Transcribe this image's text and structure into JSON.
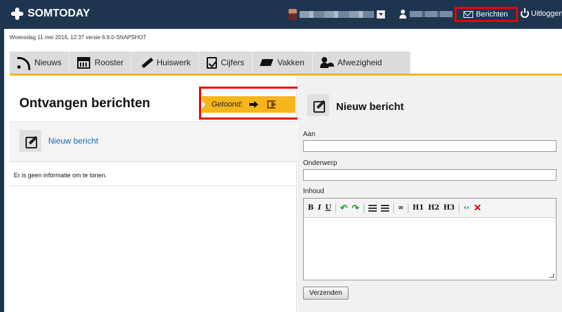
{
  "app": {
    "title": "SOMTODAY"
  },
  "header": {
    "messages_label": "Berichten",
    "logout_label": "Uitloggen"
  },
  "status_line": "Woensdag 11 mei 2016, 12:37 versie 6.9.0-SNAPSHOT",
  "tabs": [
    {
      "label": "Nieuws",
      "icon": "rss-icon"
    },
    {
      "label": "Rooster",
      "icon": "calendar-icon"
    },
    {
      "label": "Huiswerk",
      "icon": "pencil-icon"
    },
    {
      "label": "Cijfers",
      "icon": "checkbox-icon"
    },
    {
      "label": "Vakken",
      "icon": "books-icon"
    },
    {
      "label": "Afwezigheid",
      "icon": "absence-icon"
    }
  ],
  "inbox": {
    "title": "Ontvangen berichten",
    "shown_label": "Getoond:",
    "new_message_link": "Nieuw bericht",
    "empty_text": "Er is geen informatie om te tonen."
  },
  "compose": {
    "title": "Nieuw bericht",
    "to_label": "Aan",
    "to_value": "",
    "subject_label": "Onderwerp",
    "subject_value": "",
    "body_label": "Inhoud",
    "toolbar": {
      "bold": "B",
      "italic": "I",
      "underline": "U",
      "h1": "H1",
      "h2": "H2",
      "h3": "H3"
    },
    "send_label": "Verzenden"
  },
  "colors": {
    "header_bg": "#1e3550",
    "accent": "#f6b51c",
    "highlight": "#e00000",
    "link": "#1b67b3"
  }
}
